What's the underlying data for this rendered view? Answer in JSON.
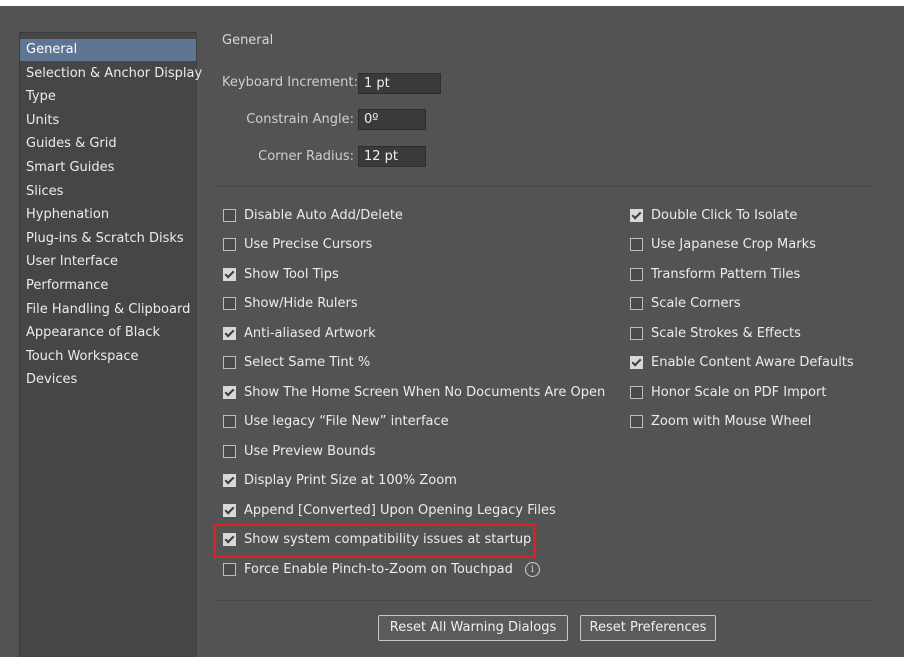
{
  "sidebar": {
    "items": [
      {
        "label": "General",
        "selected": true
      },
      {
        "label": "Selection & Anchor Display",
        "selected": false
      },
      {
        "label": "Type",
        "selected": false
      },
      {
        "label": "Units",
        "selected": false
      },
      {
        "label": "Guides & Grid",
        "selected": false
      },
      {
        "label": "Smart Guides",
        "selected": false
      },
      {
        "label": "Slices",
        "selected": false
      },
      {
        "label": "Hyphenation",
        "selected": false
      },
      {
        "label": "Plug-ins & Scratch Disks",
        "selected": false
      },
      {
        "label": "User Interface",
        "selected": false
      },
      {
        "label": "Performance",
        "selected": false
      },
      {
        "label": "File Handling & Clipboard",
        "selected": false
      },
      {
        "label": "Appearance of Black",
        "selected": false
      },
      {
        "label": "Touch Workspace",
        "selected": false
      },
      {
        "label": "Devices",
        "selected": false
      }
    ]
  },
  "main": {
    "section_title": "General",
    "fields": {
      "keyboard_increment": {
        "label": "Keyboard Increment:",
        "value": "1 pt"
      },
      "constrain_angle": {
        "label": "Constrain Angle:",
        "value": "0º"
      },
      "corner_radius": {
        "label": "Corner Radius:",
        "value": "12 pt"
      }
    },
    "left_checkboxes": [
      {
        "label": "Disable Auto Add/Delete",
        "checked": false
      },
      {
        "label": "Use Precise Cursors",
        "checked": false
      },
      {
        "label": "Show Tool Tips",
        "checked": true
      },
      {
        "label": "Show/Hide Rulers",
        "checked": false
      },
      {
        "label": "Anti-aliased Artwork",
        "checked": true
      },
      {
        "label": "Select Same Tint %",
        "checked": false
      },
      {
        "label": "Show The Home Screen When No Documents Are Open",
        "checked": true
      },
      {
        "label": "Use legacy “File New” interface",
        "checked": false
      },
      {
        "label": "Use Preview Bounds",
        "checked": false
      },
      {
        "label": "Display Print Size at 100% Zoom",
        "checked": true
      },
      {
        "label": "Append [Converted] Upon Opening Legacy Files",
        "checked": true
      },
      {
        "label": "Show system compatibility issues at startup",
        "checked": true
      },
      {
        "label": "Force Enable Pinch-to-Zoom on Touchpad",
        "checked": false
      }
    ],
    "right_checkboxes": [
      {
        "label": "Double Click To Isolate",
        "checked": true
      },
      {
        "label": "Use Japanese Crop Marks",
        "checked": false
      },
      {
        "label": "Transform Pattern Tiles",
        "checked": false
      },
      {
        "label": "Scale Corners",
        "checked": false
      },
      {
        "label": "Scale Strokes & Effects",
        "checked": false
      },
      {
        "label": "Enable Content Aware Defaults",
        "checked": true
      },
      {
        "label": "Honor Scale on PDF Import",
        "checked": false
      },
      {
        "label": "Zoom with Mouse Wheel",
        "checked": false
      }
    ],
    "info_glyph": "i",
    "buttons": {
      "reset_warnings": "Reset All Warning Dialogs",
      "reset_preferences": "Reset Preferences"
    }
  },
  "colors": {
    "panel_bg": "#535353",
    "sidebar_bg": "#464646",
    "selection": "#5e7694",
    "highlight": "#e02020"
  }
}
